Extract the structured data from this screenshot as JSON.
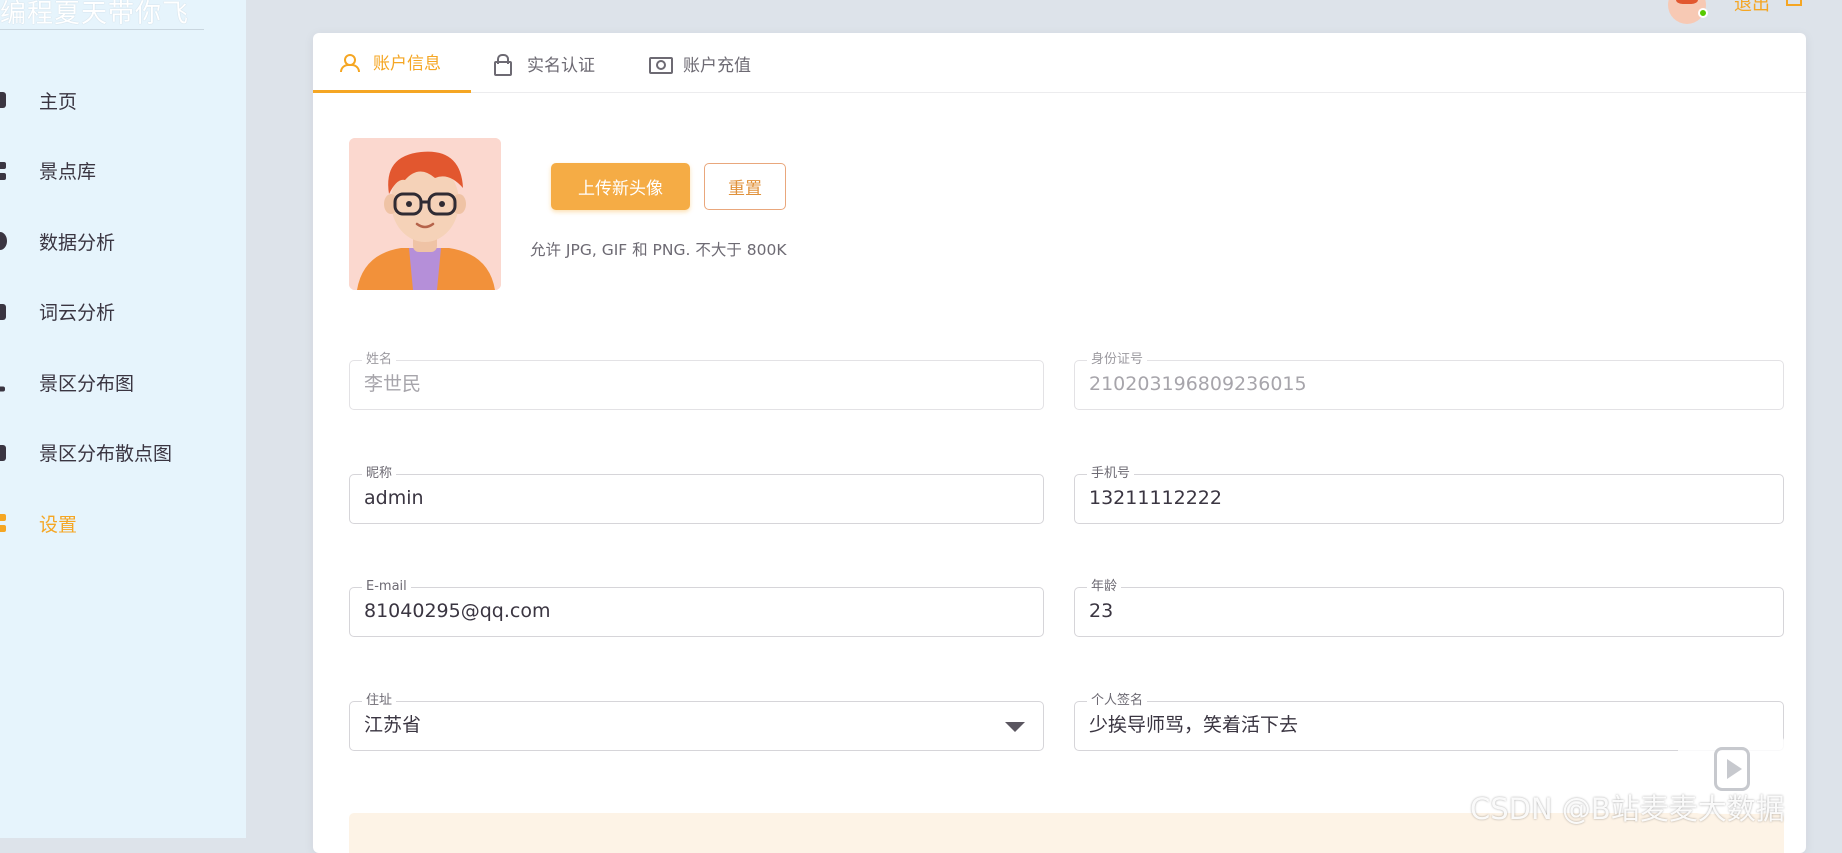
{
  "sidebar": {
    "brand": "编程夏天带你飞",
    "items": [
      {
        "label": "主页",
        "icon": "home-icon"
      },
      {
        "label": "景点库",
        "icon": "grid-icon"
      },
      {
        "label": "数据分析",
        "icon": "pie-chart-icon"
      },
      {
        "label": "词云分析",
        "icon": "cloud-icon"
      },
      {
        "label": "景区分布图",
        "icon": "map-icon"
      },
      {
        "label": "景区分布散点图",
        "icon": "scatter-icon"
      },
      {
        "label": "设置",
        "icon": "settings-icon",
        "active": true
      }
    ]
  },
  "header": {
    "logout_label": "退出"
  },
  "tabs": [
    {
      "label": "账户信息",
      "icon": "account-icon",
      "active": true
    },
    {
      "label": "实名认证",
      "icon": "lock-icon"
    },
    {
      "label": "账户充值",
      "icon": "cash-icon"
    }
  ],
  "avatar_section": {
    "upload_label": "上传新头像",
    "reset_label": "重置",
    "hint": "允许 JPG, GIF 和 PNG. 不大于 800K"
  },
  "form": {
    "name": {
      "label": "姓名",
      "value": "李世民"
    },
    "id_number": {
      "label": "身份证号",
      "value": "210203196809236015"
    },
    "nickname": {
      "label": "昵称",
      "value": "admin"
    },
    "phone": {
      "label": "手机号",
      "value": "13211112222"
    },
    "email": {
      "label": "E-mail",
      "value": "81040295@qq.com"
    },
    "age": {
      "label": "年龄",
      "value": "23"
    },
    "address": {
      "label": "住址",
      "value": "江苏省"
    },
    "signature": {
      "label": "个人签名",
      "value": "少挨导师骂，笑着活下去"
    }
  },
  "overlay": {
    "credit": "CSDN @B站麦麦大数据"
  },
  "colors": {
    "accent": "#f5a623",
    "sidebar_bg": "#e6f4fc",
    "page_bg": "#dde3ea"
  }
}
